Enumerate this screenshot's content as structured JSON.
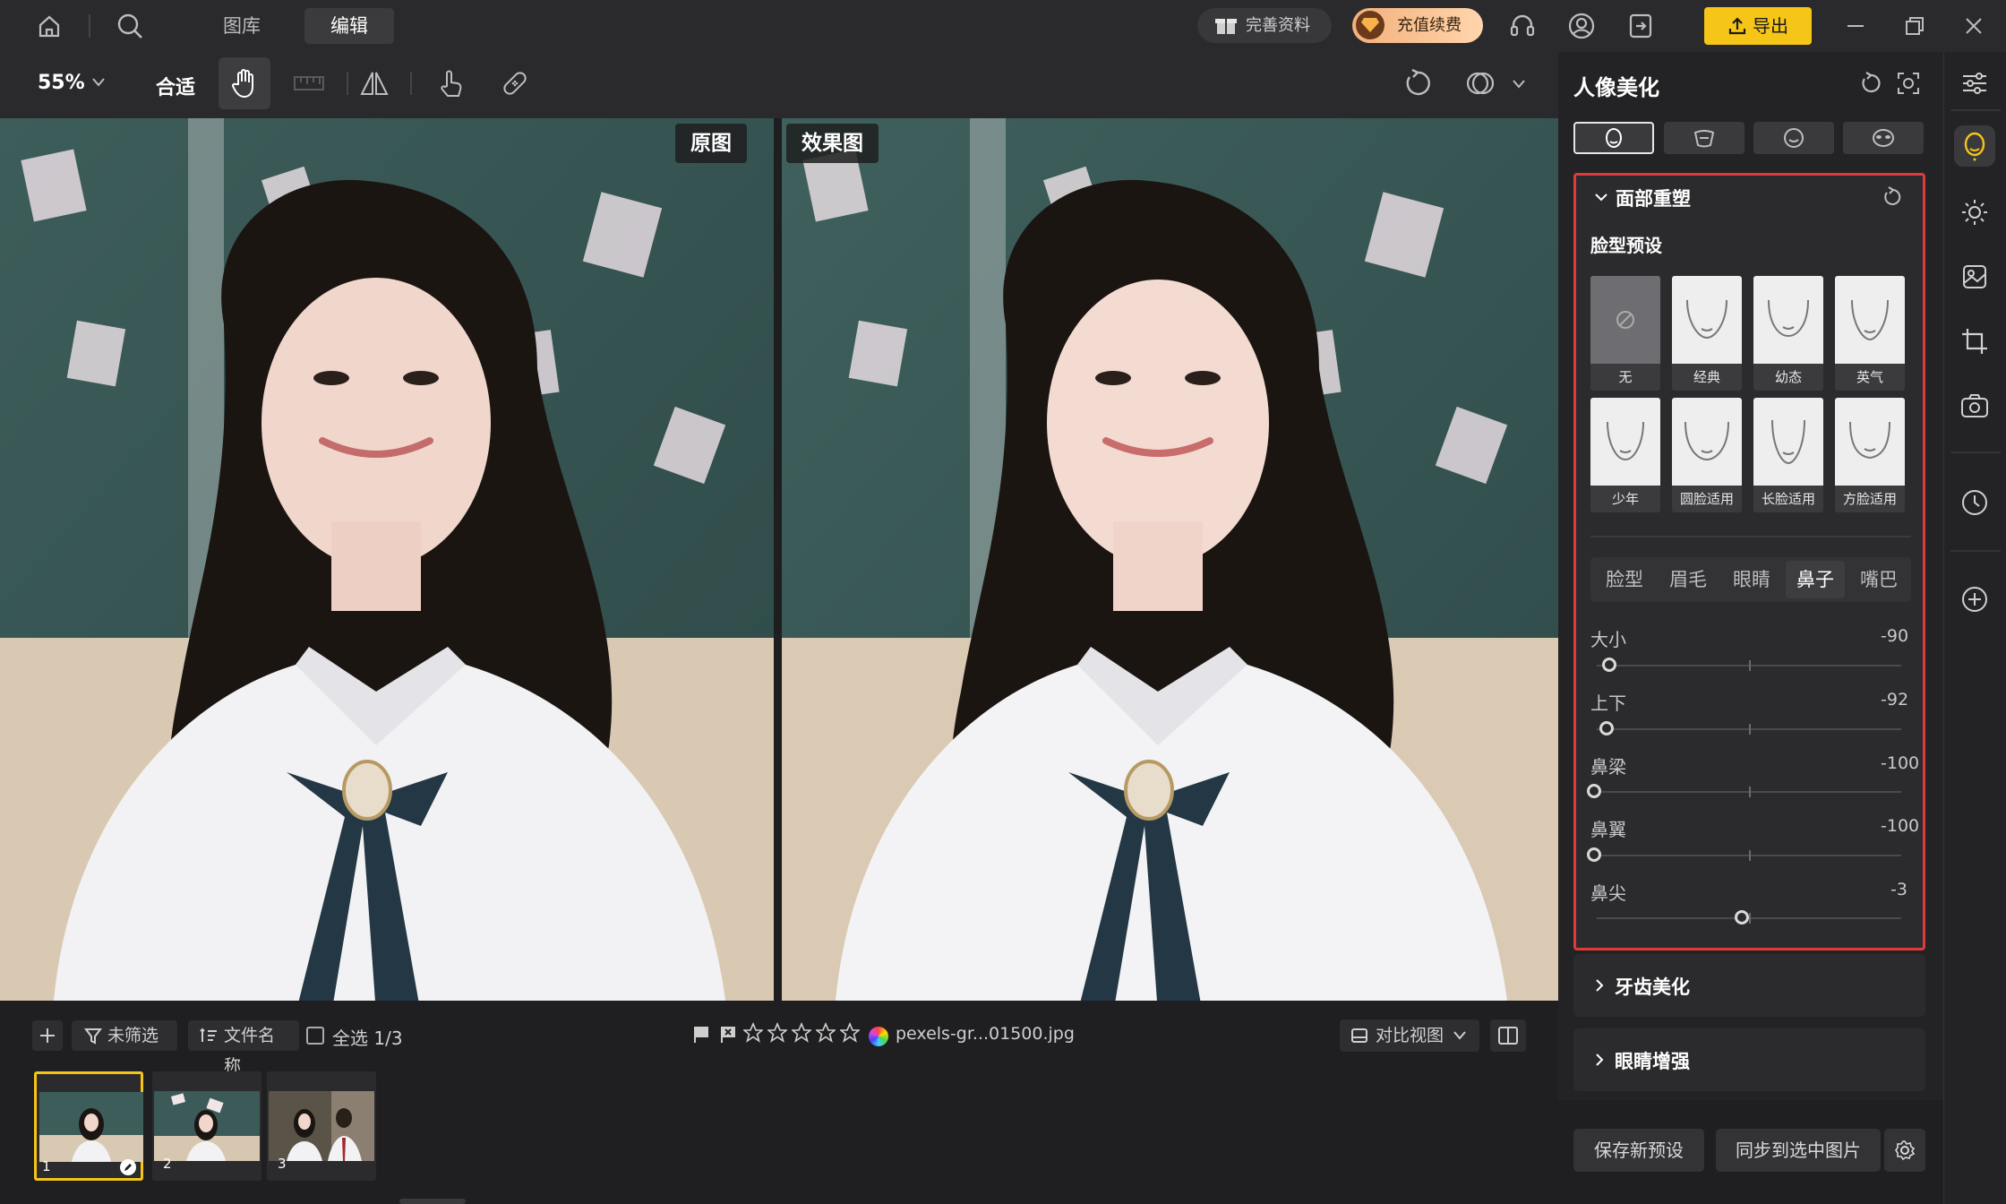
{
  "topbar": {
    "nav": [
      {
        "label": "图库"
      },
      {
        "label": "编辑"
      }
    ],
    "profile_btn": "完善资料",
    "vip_btn": "充值续费",
    "export_btn": "导出",
    "accent": "#f5c518"
  },
  "toolbar": {
    "zoom": "55%",
    "fit": "合适"
  },
  "preview": {
    "original_tag": "原图",
    "effect_tag": "效果图"
  },
  "bottom": {
    "filter": "未筛选",
    "sort": "文件名称",
    "select_all": "全选 1/3",
    "filename": "pexels-gr...01500.jpg",
    "view_mode": "对比视图",
    "thumbs": [
      "1",
      "2",
      "3"
    ]
  },
  "panel": {
    "title": "人像美化",
    "section_face": "面部重塑",
    "preset_title": "脸型预设",
    "presets": [
      {
        "label": "无"
      },
      {
        "label": "经典"
      },
      {
        "label": "幼态"
      },
      {
        "label": "英气"
      },
      {
        "label": "少年"
      },
      {
        "label": "圆脸适用"
      },
      {
        "label": "长脸适用"
      },
      {
        "label": "方脸适用"
      }
    ],
    "parts_tabs": [
      {
        "label": "脸型"
      },
      {
        "label": "眉毛"
      },
      {
        "label": "眼睛"
      },
      {
        "label": "鼻子"
      },
      {
        "label": "嘴巴"
      }
    ],
    "sliders": [
      {
        "label": "大小",
        "value": "-90",
        "level": -90
      },
      {
        "label": "上下",
        "value": "-92",
        "level": -92
      },
      {
        "label": "鼻梁",
        "value": "-100",
        "level": -100
      },
      {
        "label": "鼻翼",
        "value": "-100",
        "level": -100
      },
      {
        "label": "鼻尖",
        "value": "-3",
        "level": -3
      }
    ],
    "section_teeth": "牙齿美化",
    "section_eyes": "眼睛增强",
    "save_preset": "保存新预设",
    "sync": "同步到选中图片",
    "highlight": "#e03a3a"
  }
}
